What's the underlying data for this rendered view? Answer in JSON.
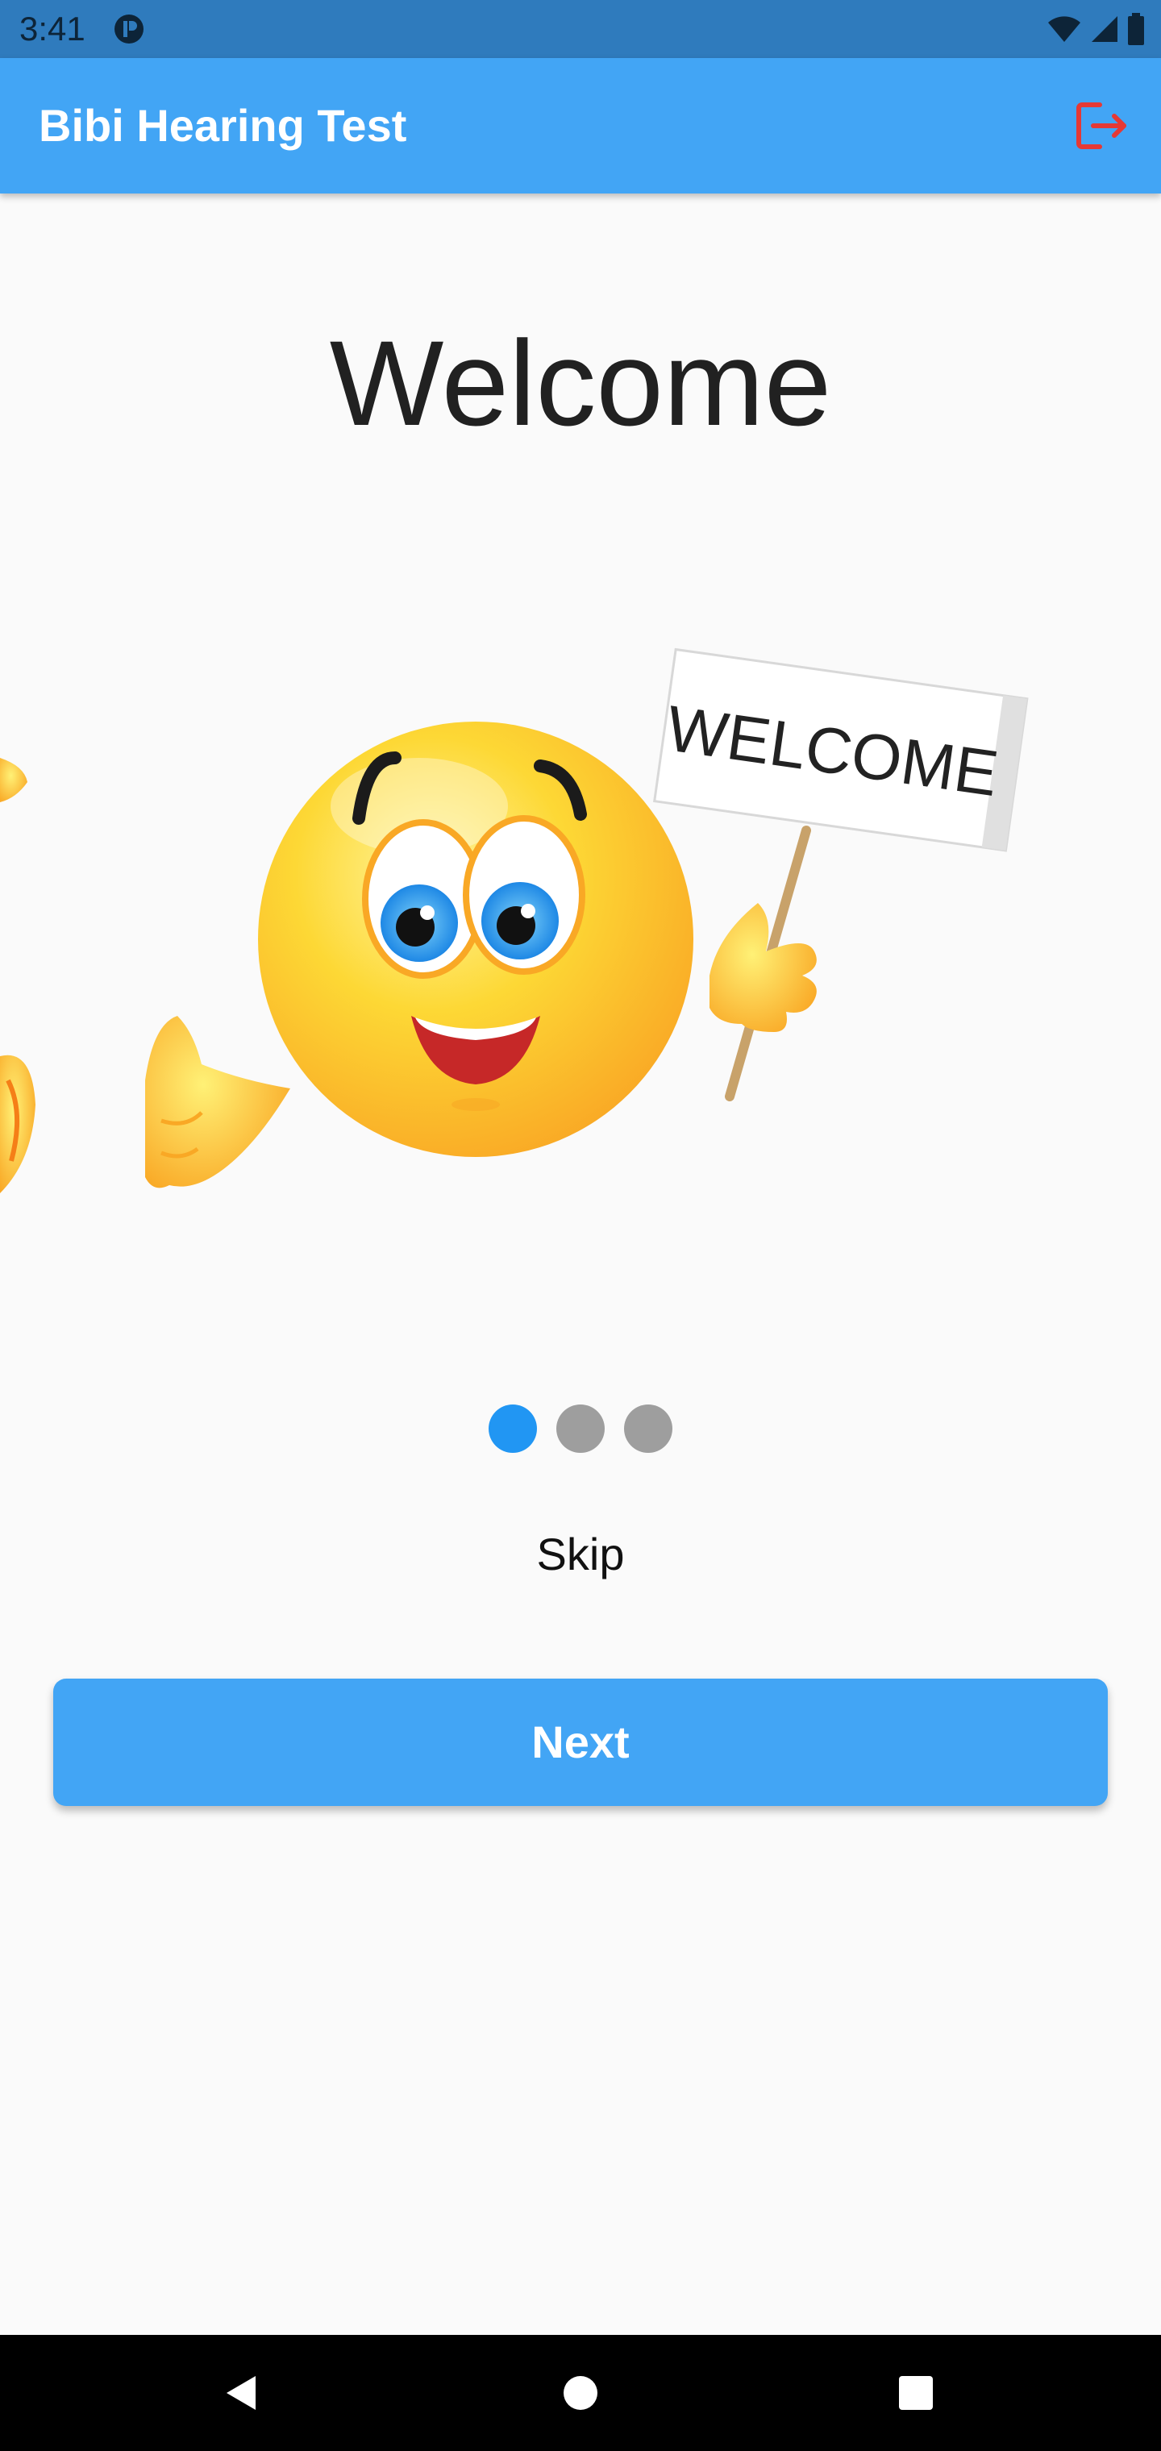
{
  "status_bar": {
    "time": "3:41"
  },
  "app_bar": {
    "title": "Bibi Hearing Test",
    "logout_icon": "logout-icon"
  },
  "onboarding": {
    "title": "Welcome",
    "sign_text": "WELCOME",
    "page_indicator": {
      "total": 3,
      "current": 1
    },
    "skip_label": "Skip",
    "next_label": "Next"
  },
  "colors": {
    "status_bar": "#2f7bbd",
    "app_bar": "#42a5f5",
    "accent": "#2196f3",
    "inactive_dot": "#9e9e9e",
    "logout_icon": "#e53935",
    "background": "#fafafa"
  },
  "nav_bar": {
    "back_icon": "back-triangle-icon",
    "home_icon": "home-circle-icon",
    "recents_icon": "recents-square-icon"
  }
}
